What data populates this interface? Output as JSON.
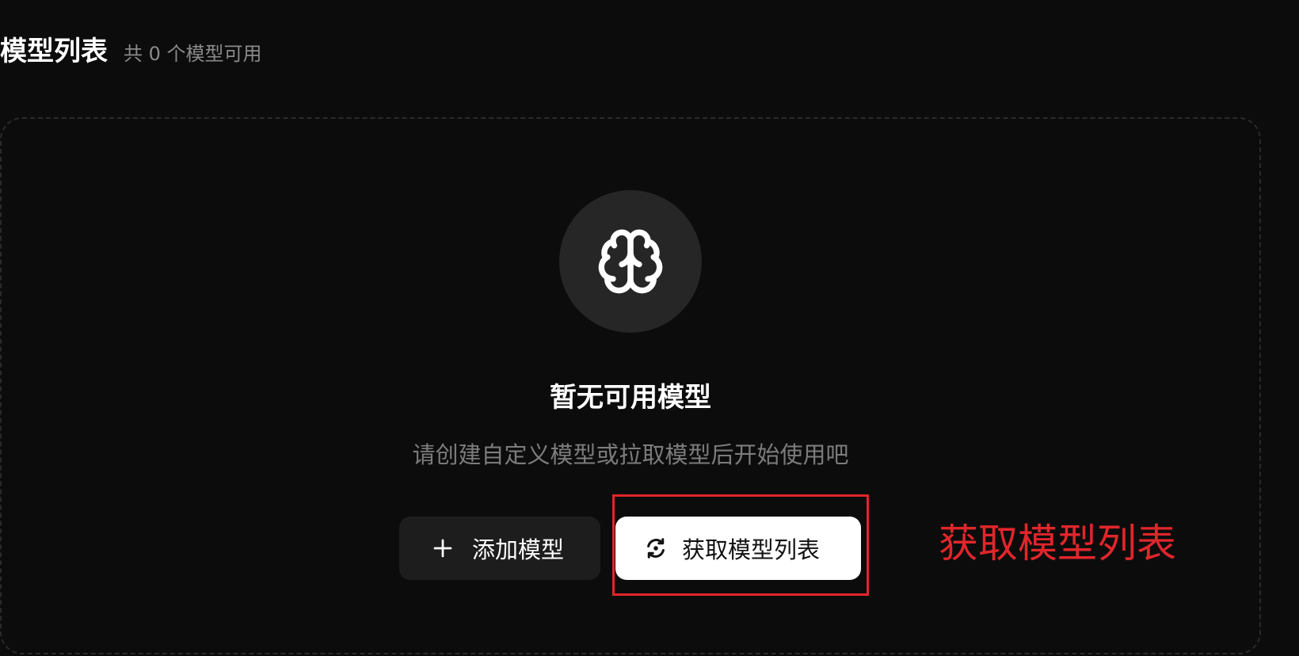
{
  "header": {
    "title": "模型列表",
    "count_text": "共 0 个模型可用"
  },
  "empty_state": {
    "icon": "brain-icon",
    "title": "暂无可用模型",
    "subtitle": "请创建自定义模型或拉取模型后开始使用吧"
  },
  "actions": {
    "add": {
      "icon": "plus-icon",
      "label": "添加模型"
    },
    "fetch": {
      "icon": "refresh-icon",
      "label": "获取模型列表"
    }
  },
  "annotation": {
    "label": "获取模型列表",
    "color": "#e0262b"
  },
  "colors": {
    "background": "#0c0c0c",
    "card_border": "#2a2a2a",
    "icon_circle": "#262626",
    "secondary_text": "#7c7c7c",
    "primary_button_bg": "#ffffff",
    "secondary_button_bg": "#1d1d1d"
  }
}
